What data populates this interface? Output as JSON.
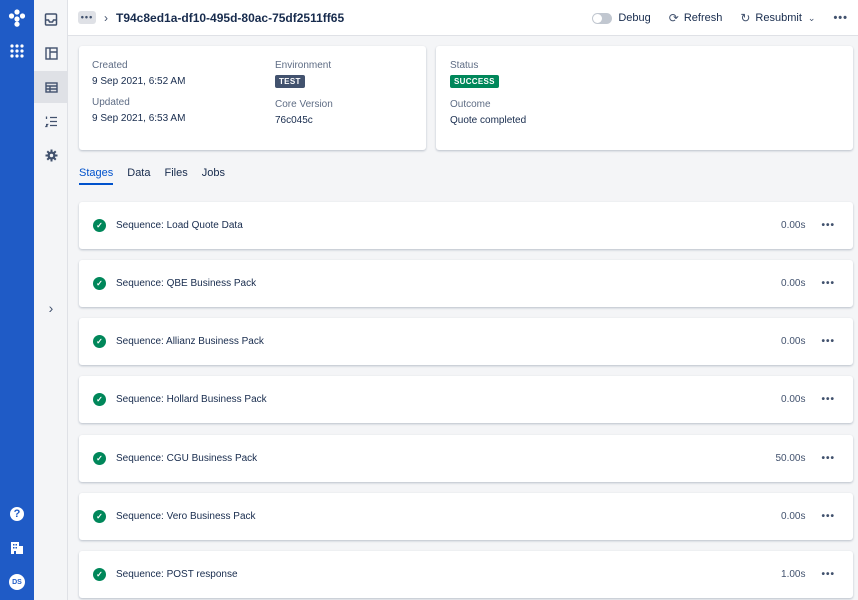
{
  "header": {
    "title": "T94c8ed1a-df10-495d-80ac-75df2511ff65",
    "debug_label": "Debug",
    "refresh_label": "Refresh",
    "resubmit_label": "Resubmit"
  },
  "rail": {
    "avatar_initials": "DS",
    "help_glyph": "?"
  },
  "info": {
    "created_label": "Created",
    "created_value": "9 Sep 2021, 6:52 AM",
    "updated_label": "Updated",
    "updated_value": "9 Sep 2021, 6:53 AM",
    "environment_label": "Environment",
    "environment_value": "TEST",
    "core_version_label": "Core Version",
    "core_version_value": "76c045c",
    "status_label": "Status",
    "status_value": "SUCCESS",
    "outcome_label": "Outcome",
    "outcome_value": "Quote completed"
  },
  "tabs": [
    "Stages",
    "Data",
    "Files",
    "Jobs"
  ],
  "stages": [
    {
      "name": "Sequence: Load Quote Data",
      "duration": "0.00s"
    },
    {
      "name": "Sequence: QBE Business Pack",
      "duration": "0.00s"
    },
    {
      "name": "Sequence: Allianz Business Pack",
      "duration": "0.00s"
    },
    {
      "name": "Sequence: Hollard Business Pack",
      "duration": "0.00s"
    },
    {
      "name": "Sequence: CGU Business Pack",
      "duration": "50.00s"
    },
    {
      "name": "Sequence: Vero Business Pack",
      "duration": "0.00s"
    },
    {
      "name": "Sequence: POST response",
      "duration": "1.00s"
    }
  ],
  "colors": {
    "rail": "#1f5bc6",
    "success": "#00875a",
    "env_lozenge": "#42526e",
    "active_tab": "#0052cc"
  },
  "icons": {
    "logo": "hexagon-cluster-logo-icon",
    "apps": "app-grid-icon",
    "help": "help-icon",
    "org": "building-icon",
    "stage_status": "check-circle-icon"
  }
}
